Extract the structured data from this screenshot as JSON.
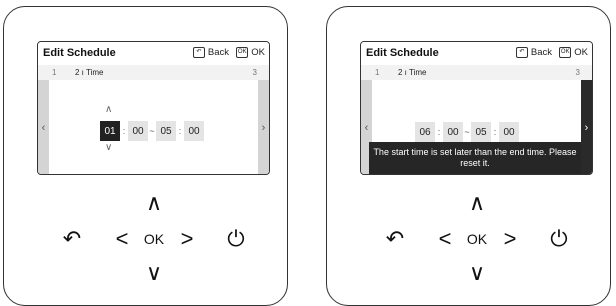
{
  "panels": [
    {
      "screen": {
        "title": "Edit Schedule",
        "back_label": "Back",
        "ok_label": "OK",
        "back_icon": "↶",
        "ok_icon": "OK",
        "steps": {
          "step1": "1",
          "step2": "2 ı Time",
          "step3": "3"
        },
        "times": [
          "01",
          "00",
          "05",
          "00"
        ],
        "separators": [
          ":",
          "~",
          ":"
        ],
        "selected_index": 0,
        "message": ""
      },
      "keypad": {
        "ok": "OK"
      }
    },
    {
      "screen": {
        "title": "Edit Schedule",
        "back_label": "Back",
        "ok_label": "OK",
        "back_icon": "↶",
        "ok_icon": "OK",
        "steps": {
          "step1": "1",
          "step2": "2 ı Time",
          "step3": "3"
        },
        "times": [
          "06",
          "00",
          "05",
          "00"
        ],
        "separators": [
          ":",
          "~",
          ":"
        ],
        "selected_index": -1,
        "message": "The start time is set later than the end time. Please reset it."
      },
      "keypad": {
        "ok": "OK"
      }
    }
  ],
  "icons": {
    "up": "∧",
    "down": "∨",
    "left": "‹",
    "right": "›",
    "back": "↶",
    "power": "⏻",
    "nav_left": "<",
    "nav_right": ">",
    "caret_up": "︿",
    "caret_down": "﹀"
  }
}
